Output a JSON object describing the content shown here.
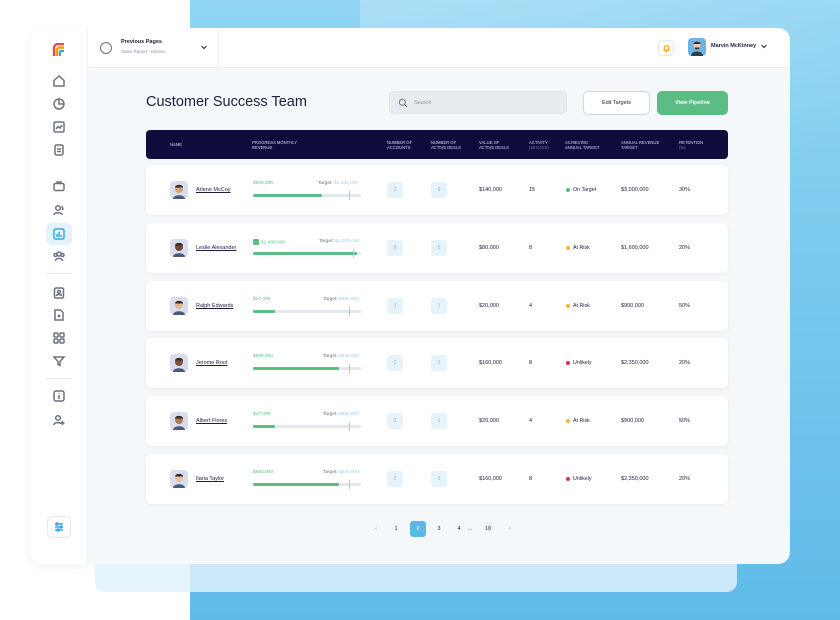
{
  "topbar": {
    "prev_title": "Previous Pages",
    "prev_sub": "Sales Report - Kleeva",
    "user_name": "Marvin McKinney"
  },
  "page": {
    "title": "Customer Success Team",
    "search_placeholder": "Search",
    "edit_label": "Edit Targets",
    "view_label": "View Pipeline"
  },
  "table": {
    "headers": {
      "name": "NAME",
      "progress": "PROGRESS MONTHLY",
      "progress2": "REVENUE",
      "accounts": "NUMBER OF",
      "accounts2": "ACCOUNTS",
      "deals": "NUMBER OF",
      "deals2": "ACTIVE DEALS",
      "value": "VALUE OF",
      "value2": "ACTIVE DEALS",
      "activity": "ACTIVITY",
      "activity_sub": "(30 DAYS)",
      "achieving": "ACHIEVING",
      "achieving2": "ANNUAL TARGET",
      "annual": "ANNUAL REVENUE",
      "annual2": "TARGET",
      "retention": "RETENTION",
      "retention_sub": "(%)"
    },
    "target_prefix": "Target:",
    "rows": [
      {
        "name": "Arlene McCoy",
        "progress": "$600,000",
        "target": "$1,100,000",
        "fill": 0.64,
        "accounts": "3",
        "deals": "9",
        "value": "$140,000",
        "activity": "15",
        "status": "On Target",
        "annual": "$3,000,000",
        "retention": "30%"
      },
      {
        "name": "Leslie Alexander",
        "progress": "$1,400,000",
        "target": "$1,200,000",
        "fill": 0.96,
        "accounts": "8",
        "deals": "5",
        "value": "$80,000",
        "activity": "8",
        "status": "At Risk",
        "annual": "$1,600,000",
        "retention": "20%"
      },
      {
        "name": "Ralph Edwards",
        "progress": "$17,000",
        "target": "$960,000",
        "fill": 0.2,
        "accounts": "3",
        "deals": "1",
        "value": "$20,000",
        "activity": "4",
        "status": "At Risk",
        "annual": "$900,000",
        "retention": "50%"
      },
      {
        "name": "Jerome Root",
        "progress": "$580,000",
        "target": "$640,000",
        "fill": 0.8,
        "accounts": "2",
        "deals": "3",
        "value": "$160,000",
        "activity": "8",
        "status": "Unlikely",
        "annual": "$2,350,000",
        "retention": "20%"
      },
      {
        "name": "Albert Flores",
        "progress": "$17,000",
        "target": "$960,000",
        "fill": 0.2,
        "accounts": "3",
        "deals": "1",
        "value": "$20,000",
        "activity": "4",
        "status": "At Risk",
        "annual": "$900,000",
        "retention": "50%"
      },
      {
        "name": "Ilaria Taylor",
        "progress": "$580,000",
        "target": "$640,000",
        "fill": 0.8,
        "accounts": "2",
        "deals": "3",
        "value": "$160,000",
        "activity": "8",
        "status": "Unlikely",
        "annual": "$2,350,000",
        "retention": "20%"
      }
    ]
  },
  "status_colors": {
    "On Target": "#5cbd84",
    "At Risk": "#f5b53f",
    "Unlikely": "#d6335a"
  },
  "pagination": {
    "prev": "‹",
    "pages": [
      "1",
      "2",
      "3",
      "4",
      "...",
      "10"
    ],
    "next": "›",
    "active": "2"
  },
  "colors": {
    "accent": "#5ab7e6",
    "green": "#5cbd84",
    "header_bg": "#0e0b3d"
  },
  "icons": [
    "home-icon",
    "pie-chart-icon",
    "chart-icon",
    "document-icon",
    "briefcase-icon",
    "users-icon",
    "analytics-icon",
    "team-icon",
    "contact-icon",
    "file-icon",
    "grid-icon",
    "filter-icon",
    "info-icon",
    "user-add-icon",
    "settings-icon"
  ]
}
